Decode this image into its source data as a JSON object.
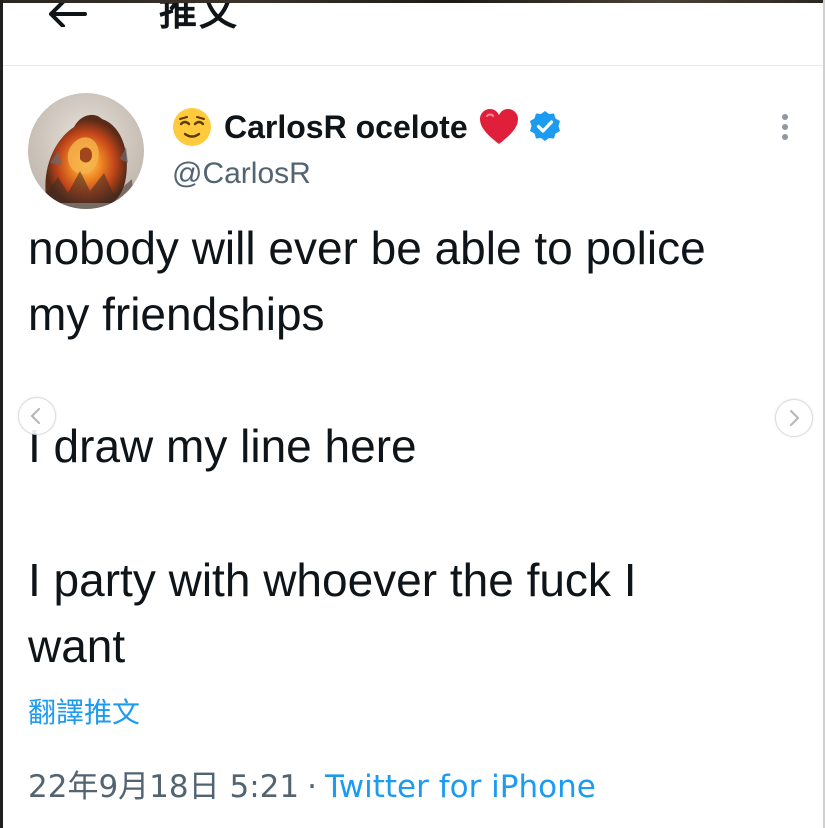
{
  "header": {
    "title": "推文"
  },
  "author": {
    "display_name": "CarlosR ocelote",
    "handle": "@CarlosR",
    "verified": true,
    "name_emoji": "relieved-face",
    "name_suffix_emoji": "red-heart"
  },
  "tweet": {
    "lines": [
      "nobody will ever be able to police",
      "my friendships",
      "I draw my line here",
      "I party with whoever the fuck I",
      "want"
    ],
    "translate_label": "翻譯推文",
    "timestamp": "22年9月18日 5:21",
    "separator": "·",
    "source": "Twitter for iPhone"
  },
  "colors": {
    "accent": "#1d9bf0",
    "text": "#0f1419",
    "secondary_text": "#536471",
    "verified_badge": "#1d9bf0",
    "heart": "#e0203a"
  }
}
